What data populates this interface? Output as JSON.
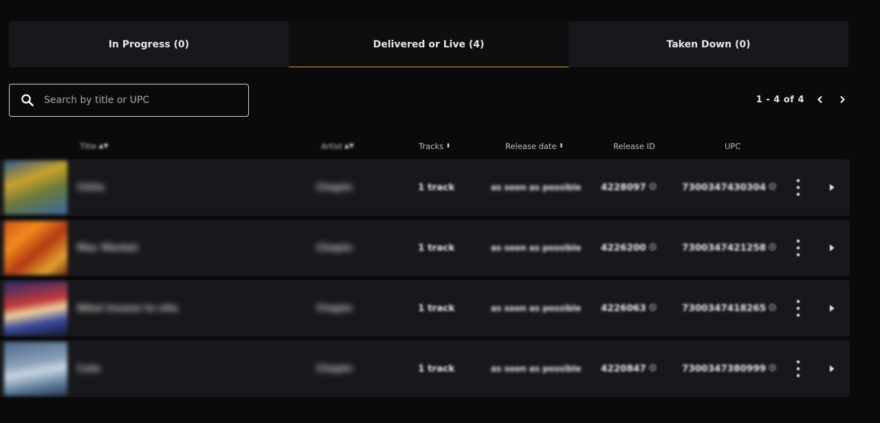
{
  "tabs": [
    {
      "label": "In Progress (0)",
      "active": false
    },
    {
      "label": "Delivered or Live (4)",
      "active": true
    },
    {
      "label": "Taken Down (0)",
      "active": false
    }
  ],
  "search": {
    "placeholder": "Search by title or UPC",
    "value": ""
  },
  "pagination": {
    "range": "1 - 4 of 4"
  },
  "columns": {
    "title": "Title",
    "artist": "Artist",
    "tracks": "Tracks",
    "release_date": "Release date",
    "release_id": "Release ID",
    "upc": "UPC"
  },
  "colors": {
    "accent": "#d6ad2c",
    "row_bg": "#17181b",
    "tab_bg": "#16181b"
  },
  "rows": [
    {
      "title": "Chito",
      "artist": "Chapin",
      "tracks": "1 track",
      "release_date": "as soon as possible",
      "release_id": "4228097",
      "upc": "7300347430304"
    },
    {
      "title": "Mac Market",
      "artist": "Chapin",
      "tracks": "1 track",
      "release_date": "as soon as possible",
      "release_id": "4226200",
      "upc": "7300347421258"
    },
    {
      "title": "Nikol Insane to site",
      "artist": "Chapin",
      "tracks": "1 track",
      "release_date": "as soon as possible",
      "release_id": "4226063",
      "upc": "7300347418265"
    },
    {
      "title": "Cuts",
      "artist": "Chapin",
      "tracks": "1 track",
      "release_date": "as soon as possible",
      "release_id": "4220847",
      "upc": "7300347380999"
    }
  ]
}
